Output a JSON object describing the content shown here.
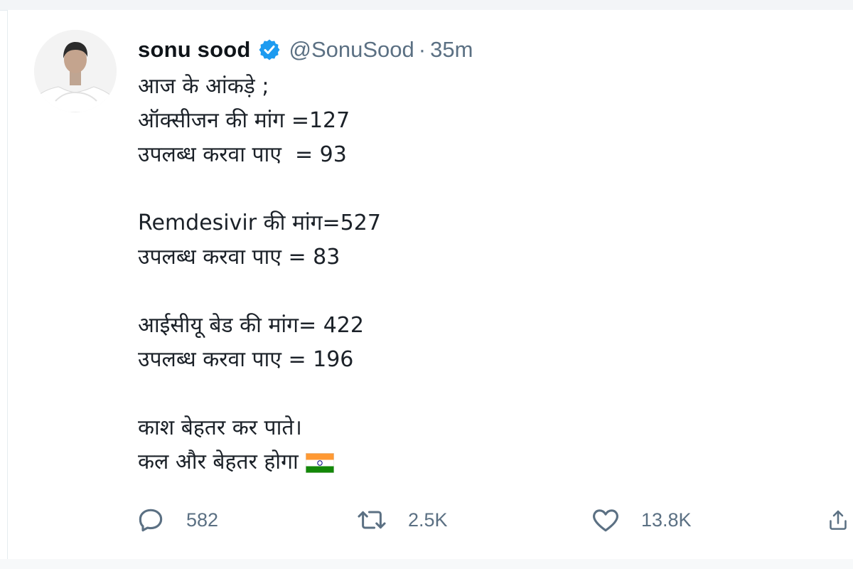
{
  "tweet": {
    "display_name": "sonu sood",
    "handle": "@SonuSood",
    "separator": "·",
    "time": "35m",
    "verified": true,
    "lines": [
      "आज के आंकड़े ;",
      "ऑक्सीजन की मांग =127",
      "उपलब्ध करवा पाए  = 93",
      "",
      "Remdesivir की मांग=527",
      "उपलब्ध करवा पाए = 83",
      "",
      "आईसीयू बेड की मांग= 422",
      "उपलब्ध करवा पाए = 196",
      "",
      "काश बेहतर कर पाते।",
      "कल और बेहतर होगा"
    ],
    "emoji": "india-flag"
  },
  "actions": {
    "reply_count": "582",
    "retweet_count": "2.5K",
    "like_count": "13.8K"
  },
  "icons": {
    "reply": "reply-icon",
    "retweet": "retweet-icon",
    "like": "heart-icon",
    "share": "share-icon",
    "verified": "verified-badge-icon"
  },
  "colors": {
    "verified_blue": "#1d9bf0",
    "secondary_text": "#5b7083",
    "flag_saffron": "#ff9933",
    "flag_green": "#138808",
    "flag_chakra": "#000080"
  }
}
